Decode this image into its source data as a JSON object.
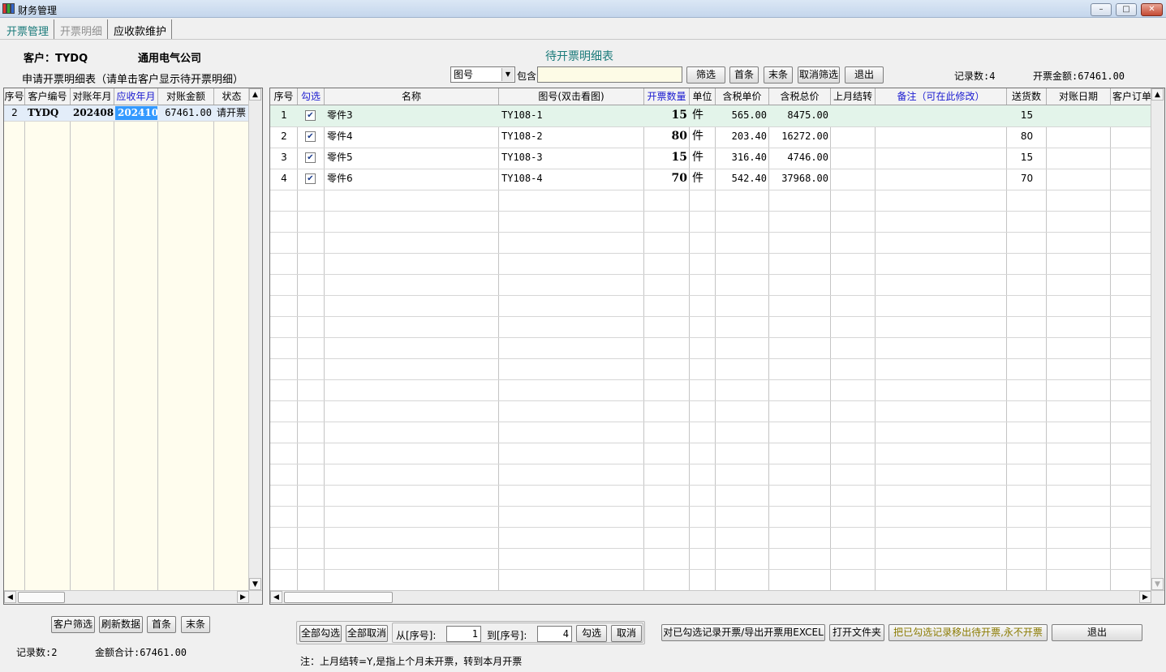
{
  "window": {
    "title": "财务管理"
  },
  "tabs": [
    {
      "label": "开票管理",
      "state": "active"
    },
    {
      "label": "开票明细",
      "state": "disabled"
    },
    {
      "label": "应收款维护",
      "state": "normal"
    }
  ],
  "customer": {
    "label": "客户：TYDQ",
    "name": "通用电气公司"
  },
  "left_panel": {
    "caption": "申请开票明细表（请单击客户显示待开票明细）",
    "columns": [
      "序号",
      "客户编号",
      "对账年月",
      "应收年月",
      "对账金额",
      "状态"
    ],
    "rows": [
      {
        "seq": "2",
        "code": "TYDQ",
        "ym": "202408",
        "recv_ym": "202410",
        "amount": "67461.00",
        "status": "请开票"
      }
    ],
    "buttons": {
      "filter": "客户筛选",
      "refresh": "刷新数据",
      "first": "首条",
      "last": "末条"
    },
    "record_count": "记录数:2",
    "amount_total": "金额合计:67461.00"
  },
  "right_panel": {
    "caption": "待开票明细表",
    "filter": {
      "field": "图号",
      "contains_label": "包含",
      "value": ""
    },
    "buttons": {
      "filter": "筛选",
      "first": "首条",
      "last": "末条",
      "cancel_filter": "取消筛选",
      "exit": "退出"
    },
    "record_count": "记录数:4",
    "invoice_total": "开票金额:67461.00",
    "columns": [
      "序号",
      "勾选",
      "名称",
      "图号(双击看图)",
      "开票数量",
      "单位",
      "含税单价",
      "含税总价",
      "上月结转",
      "备注（可在此修改）",
      "送货数",
      "对账日期",
      "客户订单"
    ],
    "rows": [
      {
        "seq": "1",
        "checked": true,
        "name": "零件3",
        "drawing": "TY108-1",
        "qty": "15",
        "unit": "件",
        "price": "565.00",
        "total": "8475.00",
        "carry": "",
        "note": "",
        "delivered": "15",
        "date": "",
        "order": ""
      },
      {
        "seq": "2",
        "checked": true,
        "name": "零件4",
        "drawing": "TY108-2",
        "qty": "80",
        "unit": "件",
        "price": "203.40",
        "total": "16272.00",
        "carry": "",
        "note": "",
        "delivered": "80",
        "date": "",
        "order": ""
      },
      {
        "seq": "3",
        "checked": true,
        "name": "零件5",
        "drawing": "TY108-3",
        "qty": "15",
        "unit": "件",
        "price": "316.40",
        "total": "4746.00",
        "carry": "",
        "note": "",
        "delivered": "15",
        "date": "",
        "order": ""
      },
      {
        "seq": "4",
        "checked": true,
        "name": "零件6",
        "drawing": "TY108-4",
        "qty": "70",
        "unit": "件",
        "price": "542.40",
        "total": "37968.00",
        "carry": "",
        "note": "",
        "delivered": "70",
        "date": "",
        "order": ""
      }
    ]
  },
  "bottom": {
    "select_all": "全部勾选",
    "deselect_all": "全部取消",
    "from_label": "从[序号]:",
    "from_value": "1",
    "to_label": "到[序号]:",
    "to_value": "4",
    "check": "勾选",
    "cancel": "取消",
    "export": "对已勾选记录开票/导出开票用EXCEL",
    "open_folder": "打开文件夹",
    "move_out": "把已勾选记录移出待开票,永不开票",
    "exit": "退出",
    "note": "注：上月结转=Y,是指上个月未开票，转到本月开票"
  },
  "colors": {
    "selected_row": "#e3f4ea",
    "accent_text": "#1a7a7a",
    "highlight_cell": "#3399ff",
    "warn_text": "#8a7a00"
  }
}
